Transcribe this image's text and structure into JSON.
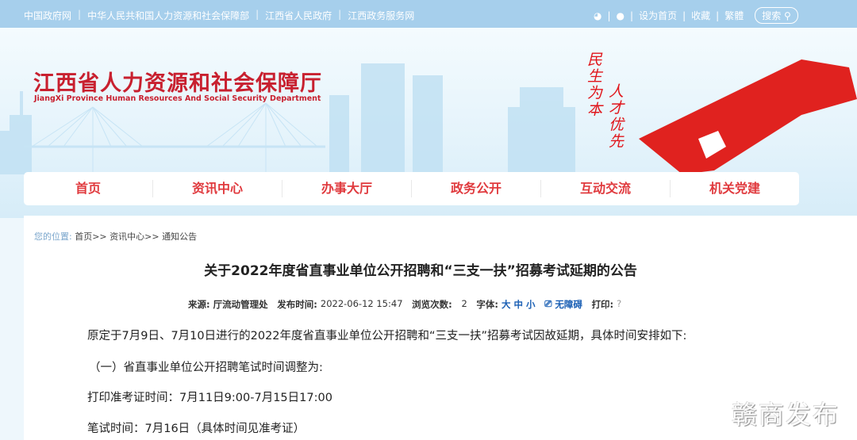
{
  "topbar": {
    "links": [
      "中国政府网",
      "中华人民共和国人力资源和社会保障部",
      "江西省人民政府",
      "江西政务服务网"
    ],
    "right": [
      "设为首页",
      "收藏",
      "繁體"
    ],
    "search": "搜索"
  },
  "header": {
    "title_cn": "江西省人力资源和社会保障厅",
    "title_en": "JiangXi Province Human Resources And Social Security Department",
    "slogan1": "民生为本",
    "slogan2": "人才优先"
  },
  "nav": [
    "首页",
    "资讯中心",
    "办事大厅",
    "政务公开",
    "互动交流",
    "机关党建"
  ],
  "breadcrumb": {
    "label": "您的位置:",
    "path": "首页>> 资讯中心>> 通知公告"
  },
  "article": {
    "title": "关于2022年度省直事业单位公开招聘和“三支一扶”招募考试延期的公告",
    "meta": {
      "source_label": "来源:",
      "source": "厅流动管理处",
      "time_label": "发布时间:",
      "time": "2022-06-12 15:47",
      "views_label": "浏览次数:",
      "views": "2",
      "font_label": "字体:",
      "font_sizes": "大 中 小",
      "accessible": "无障碍",
      "print_label": "打印:",
      "print": "?"
    },
    "paragraphs": [
      "原定于7月9日、7月10日进行的2022年度省直事业单位公开招聘和“三支一扶”招募考试因故延期，具体时间安排如下:",
      "（一）省直事业单位公开招聘笔试时间调整为:",
      "打印准考证时间：7月11日9:00-7月15日17:00",
      "笔试时间：7月16日（具体时间见准考证）"
    ]
  },
  "watermark": "赣商发布"
}
